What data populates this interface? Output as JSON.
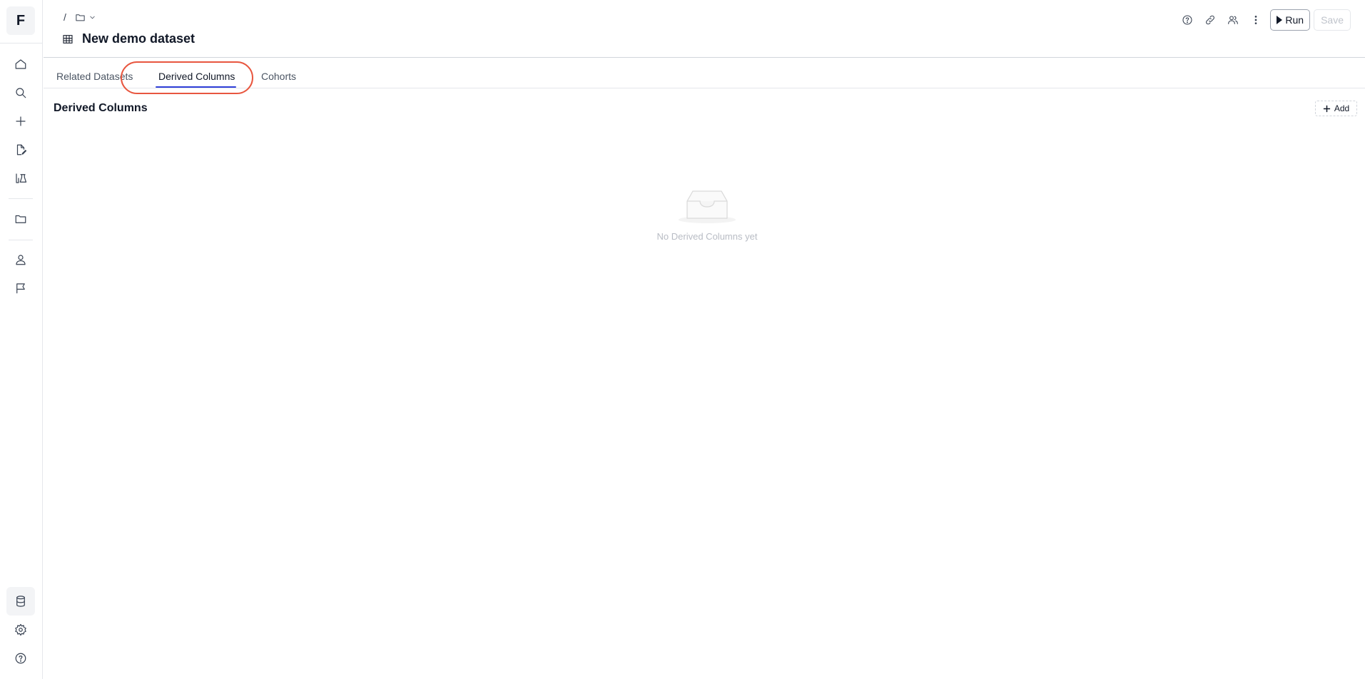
{
  "app": {
    "logo_letter": "F"
  },
  "sidebar": {
    "top_items": [
      {
        "icon": "home-icon"
      },
      {
        "icon": "search-icon"
      },
      {
        "icon": "plus-icon"
      },
      {
        "icon": "file-edit-icon"
      },
      {
        "icon": "flask-icon"
      },
      {
        "icon": "folder-icon"
      },
      {
        "icon": "user-icon"
      },
      {
        "icon": "flag-icon"
      }
    ],
    "bottom_items": [
      {
        "icon": "database-icon",
        "active": true
      },
      {
        "icon": "gear-icon"
      },
      {
        "icon": "help-icon"
      }
    ]
  },
  "header": {
    "breadcrumb_separator": "/",
    "title": "New demo dataset",
    "actions": {
      "icons": [
        "help-circle-icon",
        "link-icon",
        "users-icon",
        "more-vertical-icon"
      ],
      "run_label": "Run",
      "save_label": "Save"
    }
  },
  "tabs": [
    {
      "label": "Related Datasets",
      "active": false
    },
    {
      "label": "Derived Columns",
      "active": true
    },
    {
      "label": "Cohorts",
      "active": false
    }
  ],
  "content": {
    "section_title": "Derived Columns",
    "add_label": "Add",
    "empty_message": "No Derived Columns yet"
  },
  "colors": {
    "tab_underline": "#2f3fd8",
    "highlight_ring": "#e8563f"
  }
}
